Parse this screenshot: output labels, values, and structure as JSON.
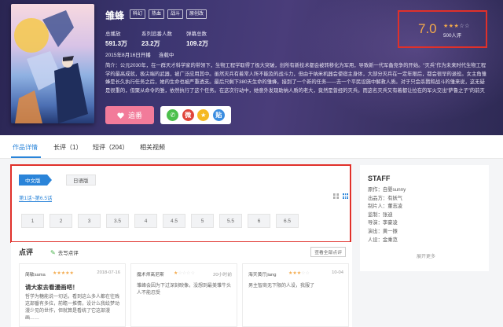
{
  "hero": {
    "title": "雏蜂",
    "tags": [
      "科幻",
      "热血",
      "战斗",
      "原创改"
    ],
    "stats": [
      {
        "label": "总播放",
        "value": "591.3万"
      },
      {
        "label": "系列追番人数",
        "value": "23.2万"
      },
      {
        "label": "弹幕总数",
        "value": "109.2万"
      }
    ],
    "air_date": "2015年8月16日开播",
    "status": "连载中",
    "synopsis": "简介：公元2030年，在一群天才科学家的带领下，生物工程学取得了极大突破，创所有新技术都会被转移化为军用，导致新一代军备竞争的开始。“灭兵”作为未来时代生物工程学的最高成就，极尖端的武器，被广泛应用其中。虽然灭兵有着常人所不能及的战斗力，但由于纳米机器会使宿主身体，大部分灭兵在一定年限后，都会很早的退役。女主角雏蜂是长久执行任务之后，她的生命也被严重透支。最后只剩下380天生命的雏蜂，接到了一个新的任务——去一个平民设施中解救人质。对于只会杀戮和战斗的雏来说，这无疑是很重的，但聚从命令的雏，依然执行了这个任务。在这次行动中，她意外发现助纳人质的老大，竟然是曾经的灭兵。而这名灭兵又有着都让拉在的军火交出“萨鲁之子”的前灭兵面孔，让阿为灭兵的战场失落而手手了解……",
    "follow_label": "追番",
    "share_icons": [
      {
        "name": "wechat",
        "glyph": "✆",
        "color": "#4bbf4b"
      },
      {
        "name": "weibo",
        "glyph": "微",
        "color": "#e0453b"
      },
      {
        "name": "qzone",
        "glyph": "★",
        "color": "#f5b923"
      },
      {
        "name": "tieba",
        "glyph": "贴",
        "color": "#3b8de0"
      }
    ],
    "rating": {
      "score": "7.0",
      "stars": 3,
      "max_stars": 5,
      "count": "500人评"
    }
  },
  "tabs": [
    "作品详情",
    "长评（1）",
    "短评（204）",
    "相关视频"
  ],
  "episodes": {
    "languages": [
      "中文版",
      "日语版"
    ],
    "range": "第1话~第6.5话",
    "list": [
      "1",
      "2",
      "3",
      "3.5",
      "4",
      "4.5",
      "5",
      "5.5",
      "6",
      "6.5"
    ]
  },
  "reviews": {
    "heading": "点评",
    "write_label": "去写点评",
    "see_all": "查看全部点评",
    "cards": [
      {
        "author": "简敏sama",
        "stars": 5,
        "date": "2018-07-16",
        "title": "请大家去看漫画吧！",
        "body": "哲学为糖能说一切话，看到这么多人都在往贱这部番有多拉，前瞻一推情，设计么我绘梦动漫少见的世作，但就算是看统了它这部漫画……"
      },
      {
        "author": "魔术师高尼斯",
        "stars": 1,
        "date": "20小时前",
        "title": "",
        "body": "雏峰会因为下过深刻映像，没想到最美雏牛头人不能忍受"
      },
      {
        "author": "海天黄厅jiang",
        "stars": 3,
        "date": "10-04",
        "title": "",
        "body": "男主智商无下限的人设，我服了"
      }
    ]
  },
  "staff": {
    "heading": "STAFF",
    "items": [
      "原作：自婴sunny",
      "出品方：有妖气",
      "制片人：董志凌",
      "监制：张迪",
      "导演：李豪凌",
      "演出：黄一振",
      "人设：金乘范"
    ],
    "more": "展开更多"
  }
}
